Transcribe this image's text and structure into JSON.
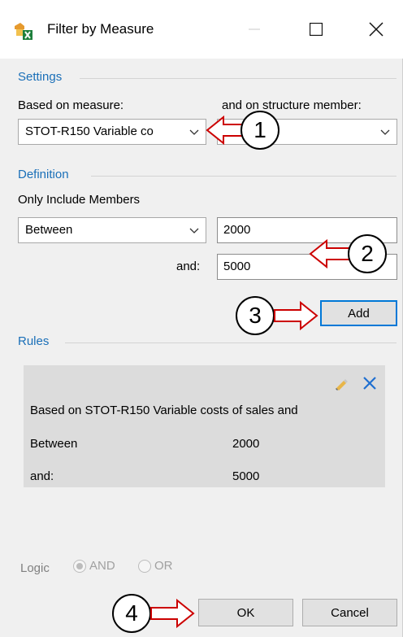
{
  "window": {
    "title": "Filter by Measure",
    "minimize_icon": "minimize-icon",
    "maximize_icon": "maximize-icon",
    "close_icon": "close-icon"
  },
  "settings": {
    "group_label": "Settings",
    "measure_label": "Based on measure:",
    "member_label": "and on structure member:",
    "measure_value": "STOT-R150 Variable co",
    "member_value": ""
  },
  "definition": {
    "group_label": "Definition",
    "include_label": "Only Include Members",
    "operator_value": "Between",
    "value1": "2000",
    "and_label": "and:",
    "value2": "5000",
    "add_label": "Add"
  },
  "rules": {
    "group_label": "Rules",
    "edit_icon": "pencil-icon",
    "delete_icon": "close-icon",
    "rows": [
      {
        "label": "Based on STOT-R150 Variable costs of sales and",
        "value": ""
      },
      {
        "label": "Between",
        "value": "2000"
      },
      {
        "label": "and:",
        "value": "5000"
      }
    ]
  },
  "logic": {
    "label": "Logic",
    "and_label": "AND",
    "or_label": "OR",
    "selected": "AND"
  },
  "footer": {
    "ok_label": "OK",
    "cancel_label": "Cancel"
  },
  "callouts": [
    "1",
    "2",
    "3",
    "4"
  ],
  "colors": {
    "group_label": "#1a6fb8",
    "focus_border": "#0078d7",
    "callout_arrow": "#cc0000"
  }
}
